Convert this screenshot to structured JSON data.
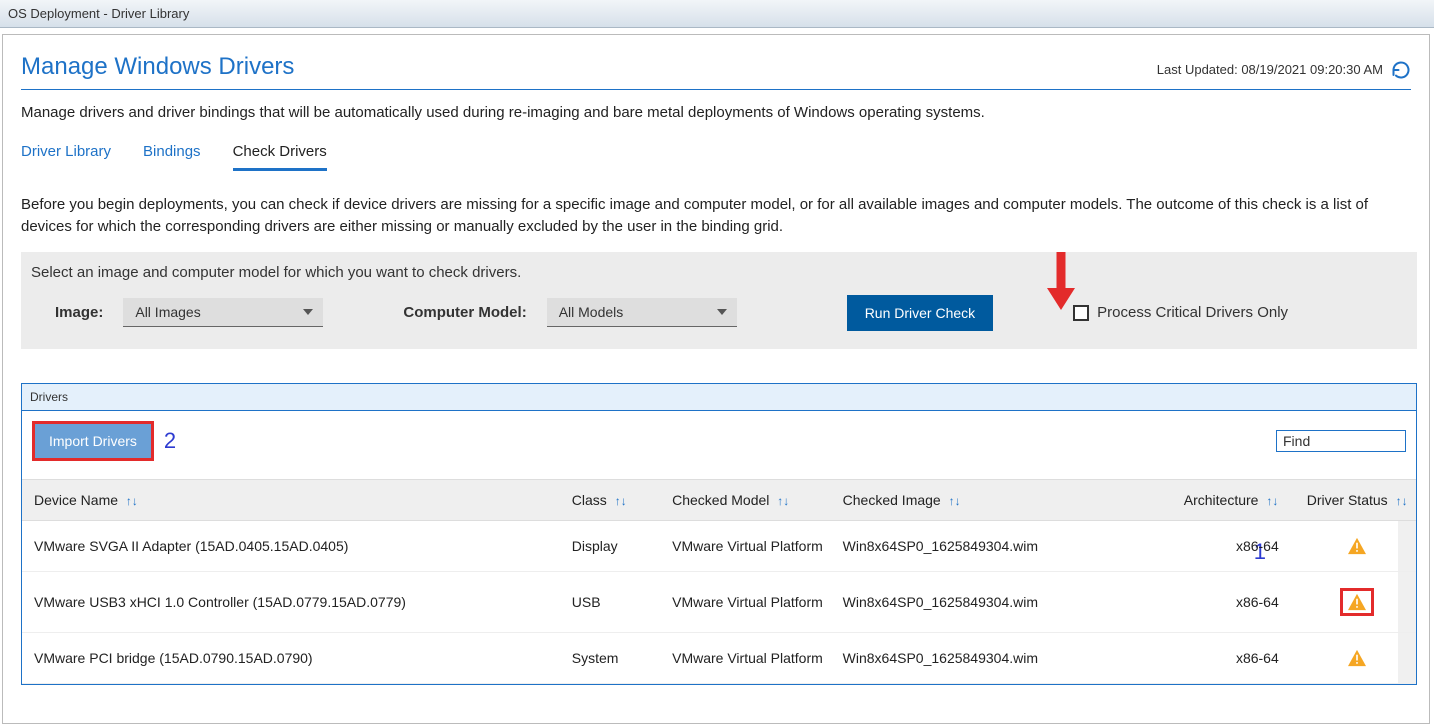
{
  "window": {
    "title": "OS Deployment - Driver Library"
  },
  "header": {
    "title": "Manage Windows Drivers",
    "last_updated_label": "Last Updated: 08/19/2021 09:20:30 AM"
  },
  "description": "Manage drivers and driver bindings that will be automatically used during re-imaging and bare metal deployments of Windows operating systems.",
  "tabs": [
    {
      "label": "Driver Library",
      "active": false
    },
    {
      "label": "Bindings",
      "active": false
    },
    {
      "label": "Check Drivers",
      "active": true
    }
  ],
  "tab_description": "Before you begin deployments, you can check if device drivers are missing for a specific image and computer model, or for all available images and computer models. The outcome of this check is a list of devices for which the corresponding drivers are either missing or manually excluded by the user in the binding grid.",
  "filter": {
    "instruction": "Select an image and computer model for which you want to check drivers.",
    "image_label": "Image:",
    "image_value": "All Images",
    "model_label": "Computer Model:",
    "model_value": "All Models",
    "run_button": "Run Driver Check",
    "critical_only_label": "Process Critical Drivers Only"
  },
  "drivers_panel": {
    "title": "Drivers",
    "import_button": "Import Drivers",
    "find_placeholder": "Find",
    "columns": {
      "device": "Device Name",
      "class": "Class",
      "model": "Checked Model",
      "image": "Checked Image",
      "arch": "Architecture",
      "status": "Driver Status"
    },
    "rows": [
      {
        "device": "VMware SVGA II Adapter (15AD.0405.15AD.0405)",
        "class": "Display",
        "model": "VMware Virtual Platform",
        "image": "Win8x64SP0_1625849304.wim",
        "arch": "x86-64",
        "status": "warning",
        "highlight": false
      },
      {
        "device": "VMware USB3 xHCI 1.0 Controller (15AD.0779.15AD.0779)",
        "class": "USB",
        "model": "VMware Virtual Platform",
        "image": "Win8x64SP0_1625849304.wim",
        "arch": "x86-64",
        "status": "warning",
        "highlight": true
      },
      {
        "device": "VMware PCI bridge (15AD.0790.15AD.0790)",
        "class": "System",
        "model": "VMware Virtual Platform",
        "image": "Win8x64SP0_1625849304.wim",
        "arch": "x86-64",
        "status": "warning",
        "highlight": false
      }
    ]
  },
  "annotations": {
    "num1": "1",
    "num2": "2",
    "arrow_color": "#e32b2b"
  }
}
